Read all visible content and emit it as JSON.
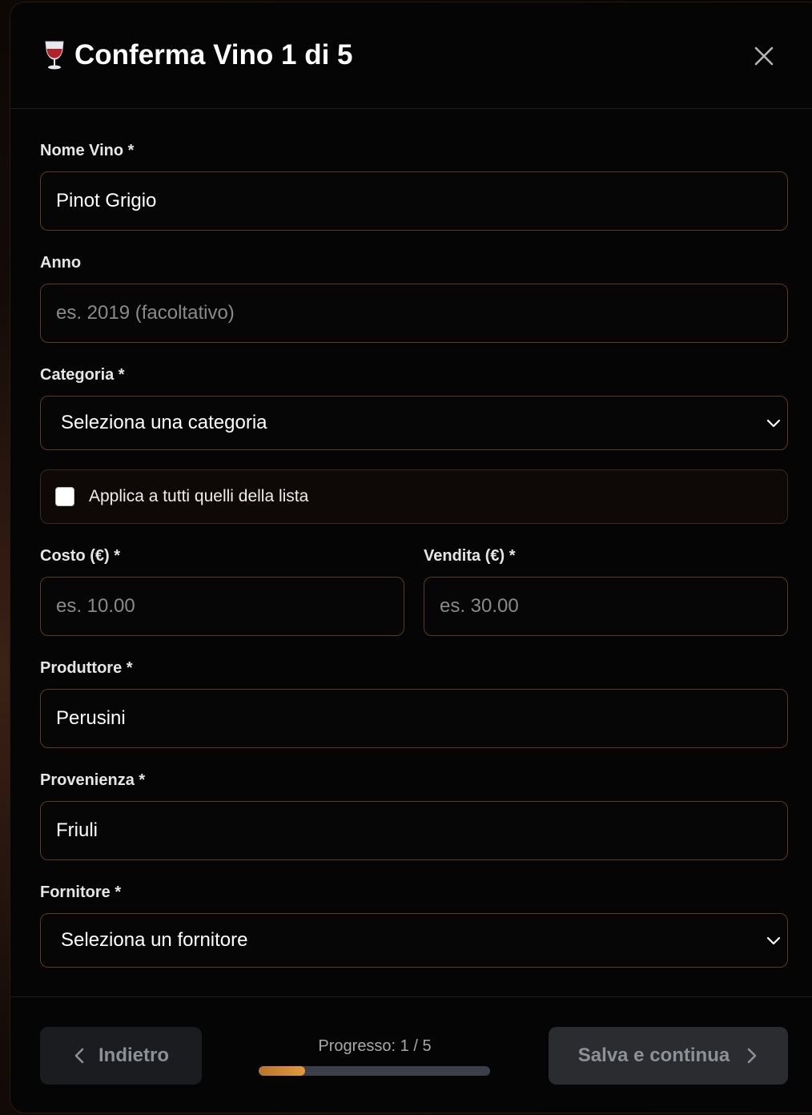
{
  "modal": {
    "title": "Conferma Vino 1 di 5",
    "title_icon": "wine-glass-icon",
    "close_icon": "close-icon"
  },
  "form": {
    "nome_vino": {
      "label": "Nome Vino *",
      "value": "Pinot Grigio"
    },
    "anno": {
      "label": "Anno",
      "placeholder": "es. 2019 (facoltativo)",
      "value": ""
    },
    "categoria": {
      "label": "Categoria *",
      "selected": "Seleziona una categoria"
    },
    "applica": {
      "label": "Applica a tutti quelli della lista",
      "checked": false
    },
    "costo": {
      "label": "Costo (€) *",
      "placeholder": "es. 10.00",
      "value": ""
    },
    "vendita": {
      "label": "Vendita (€) *",
      "placeholder": "es. 30.00",
      "value": ""
    },
    "produttore": {
      "label": "Produttore *",
      "value": "Perusini"
    },
    "provenienza": {
      "label": "Provenienza *",
      "value": "Friuli"
    },
    "fornitore": {
      "label": "Fornitore *",
      "selected": "Seleziona un fornitore"
    }
  },
  "footer": {
    "back_label": "Indietro",
    "next_label": "Salva e continua",
    "progress_text": "Progresso: 1 / 5",
    "progress_fraction": 0.2
  },
  "colors": {
    "accent": "#e39a3c",
    "border": "#5a3a24",
    "background": "#050505"
  }
}
